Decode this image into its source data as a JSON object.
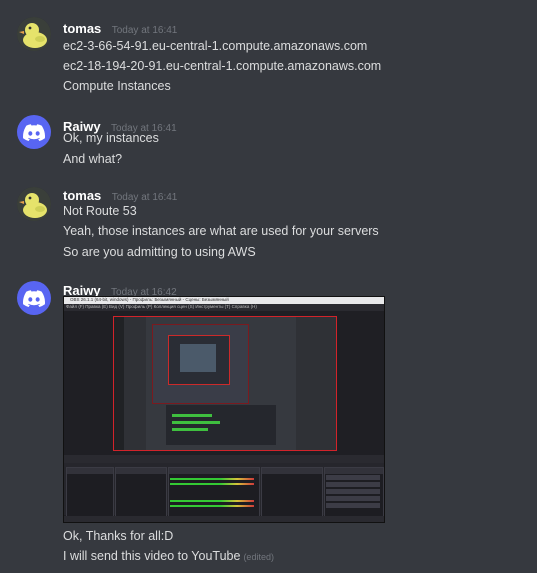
{
  "messages": [
    {
      "username": "tomas",
      "timestamp": "Today at 16:41",
      "avatar": "duck-avatar",
      "lines": [
        "ec2-3-66-54-91.eu-central-1.compute.amazonaws.com",
        "ec2-18-194-20-91.eu-central-1.compute.amazonaws.com",
        "Compute Instances"
      ]
    },
    {
      "username": "Raiwy",
      "timestamp": "Today at 16:41",
      "avatar": "discord-avatar",
      "lines": [
        "Ok, my instances",
        "And what?"
      ]
    },
    {
      "username": "tomas",
      "timestamp": "Today at 16:41",
      "avatar": "duck-avatar",
      "lines": [
        "Not Route 53",
        "Yeah, those instances are what are used for your servers",
        "So are you admitting to using AWS"
      ]
    },
    {
      "username": "Raiwy",
      "timestamp": "Today at 16:42",
      "avatar": "discord-avatar",
      "attachment": {
        "type": "image",
        "title_bar": "OBS 26.1.1 (64-bit, windows) - Профиль: Безымянный - Сцены: Безымянный",
        "menu_bar": "Файл (F)   Правка (E)   Вид (V)   Профиль (P)   Коллекция сцен (S)   Инструменты (T)   Справка (H)"
      },
      "lines": [
        "Ok, Thanks for all:D",
        "I will send this video to YouTube"
      ],
      "edited_label": "(edited)"
    }
  ],
  "colors": {
    "background": "#36393f",
    "username": "#ffffff",
    "timestamp": "#72767d",
    "text": "#dcddde",
    "discord_blurple": "#5865f2",
    "obs_border_red": "#d2232a"
  }
}
